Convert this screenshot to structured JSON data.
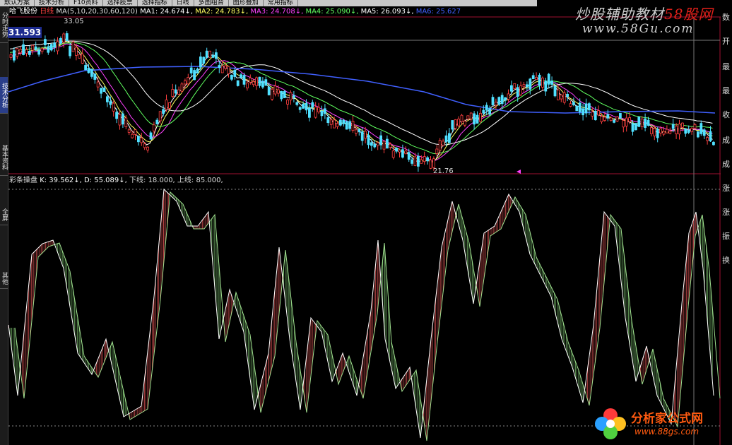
{
  "toolbar": {
    "items": [
      "默认方案",
      "技术分析",
      "F10资料",
      "选择股票",
      "选择指标",
      "日线",
      "多图组合",
      "图形叠加",
      "常用指标"
    ]
  },
  "sidebar": {
    "tabs": [
      "分时走势",
      "技术分析",
      "基本资料",
      "全屏",
      "其他"
    ]
  },
  "main_chart": {
    "stock_name": "哈飞股份",
    "period": "日线",
    "ma_params": "MA(5,10,20,30,60,120)",
    "ma1": "MA1: 24.674↓,",
    "ma2": "MA2: 24.783↓,",
    "ma3": "MA3: 24.708↓,",
    "ma4": "MA4: 25.090↓,",
    "ma5": "MA5: 26.093↓,",
    "ma6": "MA6: 25.627",
    "high_label": "33.05",
    "low_label": "21.76",
    "current_price": "31.593"
  },
  "indicator": {
    "name": "彩条操盘",
    "k": "K: 39.562↓,",
    "d": "D: 55.089↓,",
    "lower": "下线: 18.000,",
    "upper": "上线: 85.000,"
  },
  "right_panel": {
    "labels": [
      "数",
      "开",
      "最",
      "最",
      "收",
      "成",
      "成",
      "涨",
      "涨",
      "振",
      "换"
    ]
  },
  "watermark": {
    "line1": "炒股辅助教材",
    "line1_brand": "58股网",
    "line2": "www.58Gu.com"
  },
  "logo": {
    "title": "分析家公式网",
    "url": "www.88gs.com"
  },
  "colors": {
    "up": "#ff4040",
    "down": "#50e0ff",
    "k_line": "#ffffff",
    "d_line": "#a0e090",
    "ma1": "#ffffff",
    "ma2": "#ffff60",
    "ma3": "#ff40ff",
    "ma4": "#60ff60",
    "ma5": "#ffffff",
    "ma6": "#4060ff"
  }
}
